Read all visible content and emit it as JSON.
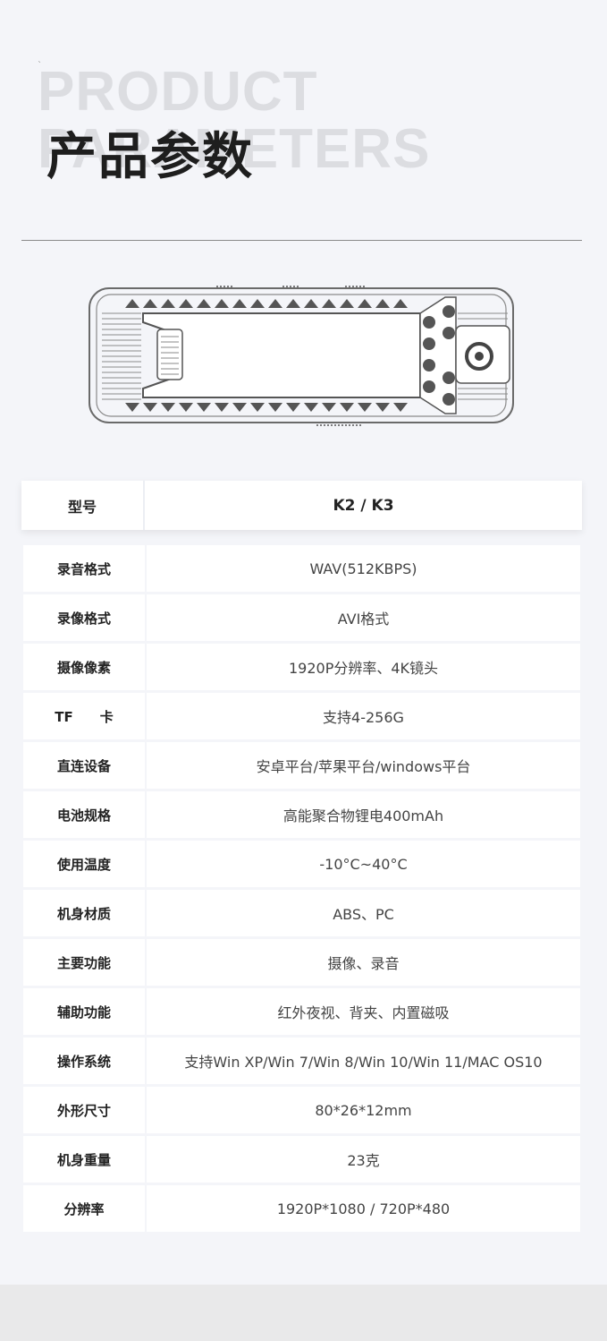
{
  "header": {
    "bg_line1": "PRODUCT",
    "bg_line2": "PARAMETERS",
    "tick": "`",
    "title": "产品参数"
  },
  "spec_header": {
    "label": "型号",
    "value": "K2 / K3"
  },
  "specs": [
    {
      "label": "录音格式",
      "value": "WAV(512KBPS)"
    },
    {
      "label": "录像格式",
      "value": "AVI格式"
    },
    {
      "label": "摄像像素",
      "value": "1920P分辨率、4K镜头"
    },
    {
      "label": "TF　　卡",
      "value": "支持4-256G"
    },
    {
      "label": "直连设备",
      "value": "安卓平台/苹果平台/windows平台"
    },
    {
      "label": "电池规格",
      "value": "高能聚合物锂电400mAh"
    },
    {
      "label": "使用温度",
      "value": "-10°C~40°C"
    },
    {
      "label": "机身材质",
      "value": "ABS、PC"
    },
    {
      "label": "主要功能",
      "value": "摄像、录音"
    },
    {
      "label": "辅助功能",
      "value": "红外夜视、背夹、内置磁吸"
    },
    {
      "label": "操作系统",
      "value": "支持Win XP/Win 7/Win 8/Win 10/Win 11/MAC OS10"
    },
    {
      "label": "外形尺寸",
      "value": "80*26*12mm"
    },
    {
      "label": "机身重量",
      "value": "23克"
    },
    {
      "label": "分辨率",
      "value": "1920P*1080 / 720P*480"
    }
  ]
}
